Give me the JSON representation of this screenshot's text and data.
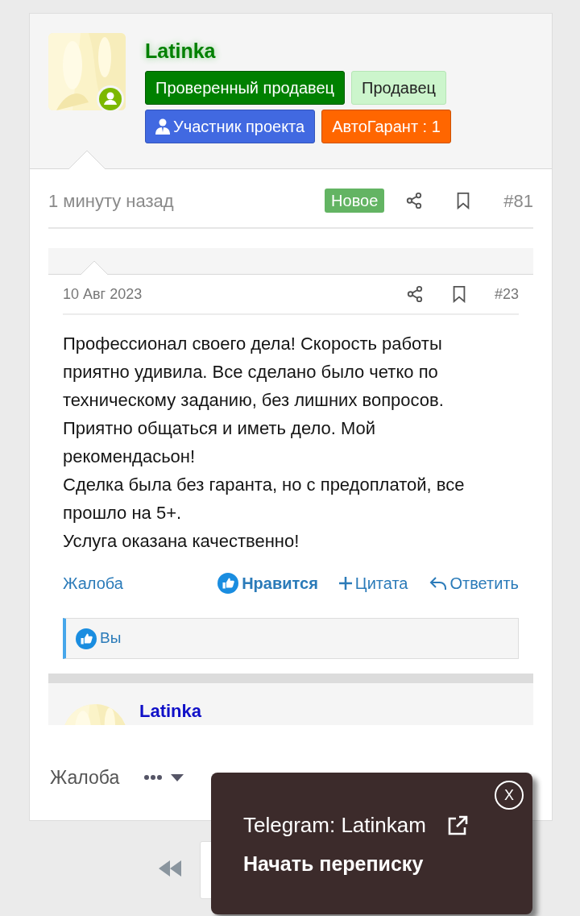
{
  "author": {
    "name": "Latinka",
    "online": true,
    "badges": [
      {
        "kind": "verified",
        "text": "Проверенный продавец"
      },
      {
        "kind": "seller",
        "text": "Продавец"
      },
      {
        "kind": "member",
        "text": "Участник проекта"
      },
      {
        "kind": "guarantee",
        "text": "АвтоГарант : 1"
      }
    ]
  },
  "post": {
    "time": "1 минуту назад",
    "new_label": "Новое",
    "number": "#81"
  },
  "quote": {
    "date": "10 Авг 2023",
    "number": "#23",
    "paragraphs": [
      "Профессионал своего дела! Скорость работы приятно удивила. Все сделано было четко по техническому заданию, без лишних вопросов. Приятно общаться и иметь дело. Мой рекомендасьон!",
      "Сделка была без гаранта, но с предоплатой, все прошло на 5+.",
      "Услуга оказана качественно!"
    ],
    "actions": {
      "report": "Жалоба",
      "like": "Нравится",
      "liked": true,
      "quote": "Цитата",
      "reply": "Ответить"
    },
    "likes": "Вы",
    "next_author": "Latinka"
  },
  "post_actions": {
    "report": "Жалоба"
  },
  "popup": {
    "close": "X",
    "contact": "Telegram: Latinkam",
    "start_chat": "Начать переписку"
  }
}
